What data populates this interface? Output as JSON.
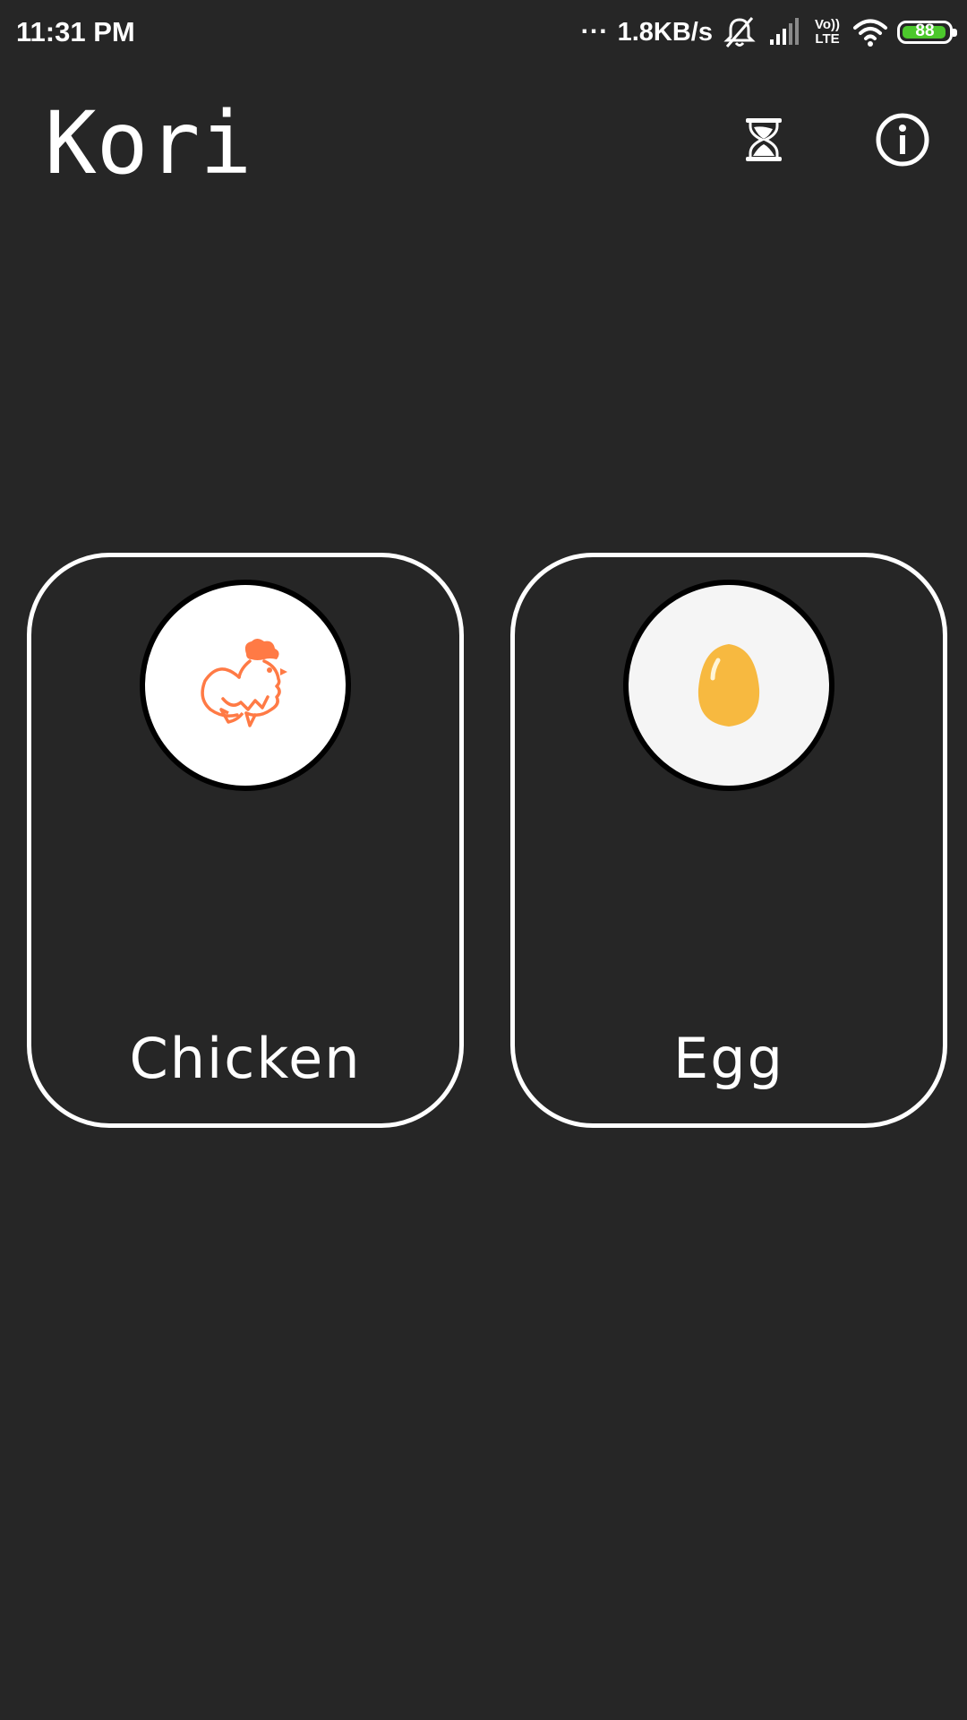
{
  "status_bar": {
    "time": "11:31 PM",
    "dots": "...",
    "network_speed": "1.8KB/s",
    "icons": [
      "bell-off-icon",
      "signal-icon",
      "volte-icon",
      "wifi-icon",
      "battery-icon"
    ],
    "volte_label_top": "Vo))",
    "volte_label_bottom": "LTE",
    "battery_level": "88",
    "battery_color": "#4cc82c"
  },
  "header": {
    "title": "Kori",
    "actions": [
      "hourglass-icon",
      "info-icon"
    ]
  },
  "cards": [
    {
      "label": "Chicken",
      "icon": "rooster-icon",
      "accent": "#ff7a45"
    },
    {
      "label": "Egg",
      "icon": "egg-icon",
      "accent": "#f7b940"
    }
  ],
  "colors": {
    "background": "#262626",
    "foreground": "#ffffff"
  }
}
